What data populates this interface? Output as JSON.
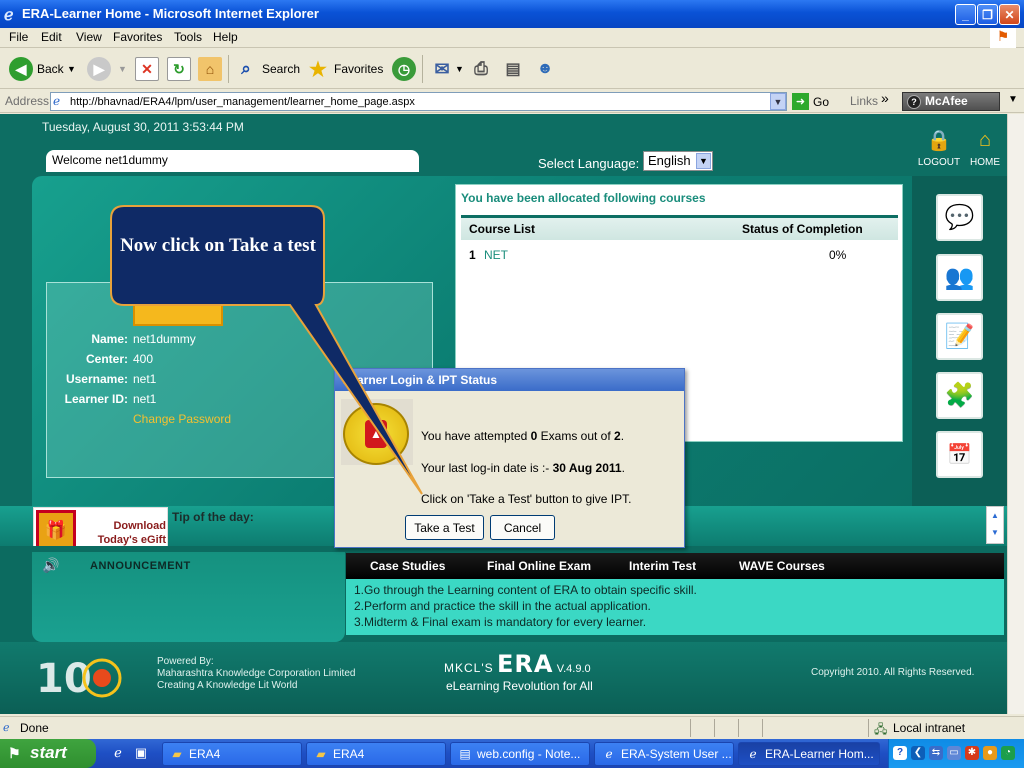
{
  "window": {
    "title": "ERA-Learner Home - Microsoft Internet Explorer",
    "minimize": "_",
    "maximize": "❐",
    "close": "✕"
  },
  "menu": [
    "File",
    "Edit",
    "View",
    "Favorites",
    "Tools",
    "Help"
  ],
  "toolbar": {
    "back_label": "Back",
    "search_label": "Search",
    "favorites_label": "Favorites"
  },
  "addressbar": {
    "label": "Address",
    "url": "http://bhavnad/ERA4/lpm/user_management/learner_home_page.aspx",
    "go_label": "Go",
    "links_label": "Links",
    "mcafee_label": "McAfee"
  },
  "page": {
    "datetime": "Tuesday, August 30, 2011 3:53:44 PM",
    "welcome": "Welcome net1dummy",
    "language_label": "Select Language:",
    "language_value": "English",
    "logout_label": "LOGOUT",
    "home_label": "HOME",
    "profile": {
      "name_label": "Name:",
      "name_value": "net1dummy",
      "center_label": "Center:",
      "center_value": "400",
      "username_label": "Username:",
      "username_value": "net1",
      "learnerid_label": "Learner ID:",
      "learnerid_value": "net1",
      "change_password": "Change Password"
    },
    "courses": {
      "title": "You have been allocated following courses",
      "col_list": "Course List",
      "col_status": "Status of Completion",
      "rows": [
        {
          "num": "1",
          "name": "NET",
          "status": "0%"
        }
      ]
    },
    "egift": {
      "line1": "Download",
      "line2": "Today's eGift"
    },
    "tip_label": "Tip of the day:",
    "announcement_label": "ANNOUNCEMENT",
    "tabs": [
      "Case Studies",
      "Final Online Exam",
      "Interim Test",
      "WAVE Courses"
    ],
    "tips": [
      "1.Go through the Learning content of ERA to obtain specific skill.",
      "2.Perform and practice the skill in the actual application.",
      "3.Midterm & Final exam is mandatory for every learner."
    ],
    "footer": {
      "powered_label": "Powered By:",
      "company": "Maharashtra Knowledge Corporation Limited",
      "tagline": "Creating A Knowledge Lit World",
      "era_prefix": "MKCL'S",
      "era_name": "ERA",
      "era_version": "V.4.9.0",
      "era_tagline": "eLearning Revolution for All",
      "copyright": "Copyright 2010. All Rights Reserved."
    }
  },
  "dialog": {
    "title": "Learner Login & IPT Status",
    "attempt_pre": "You have attempted ",
    "attempted": "0",
    "attempt_mid": " Exams out of ",
    "total": "2",
    "attempt_post": ".",
    "last_login_pre": "Your last log-in date is :- ",
    "last_login_date": "30 Aug 2011",
    "last_login_post": ".",
    "instruction": "Click on 'Take a Test' button to give IPT.",
    "take_test_label": "Take a Test",
    "cancel_label": "Cancel"
  },
  "callout": {
    "text": "Now click on Take a test"
  },
  "status": {
    "text": "Done",
    "zone": "Local intranet"
  },
  "taskbar": {
    "start_label": "start",
    "tasks": [
      "ERA4",
      "ERA4",
      "web.config - Note...",
      "ERA-System User ...",
      "ERA-Learner Hom..."
    ]
  },
  "colors": {
    "page_teal": "#0d6e63",
    "xp_blue": "#0a52d6",
    "callout_navy": "#0f2a66",
    "callout_border": "#e8a23a"
  }
}
